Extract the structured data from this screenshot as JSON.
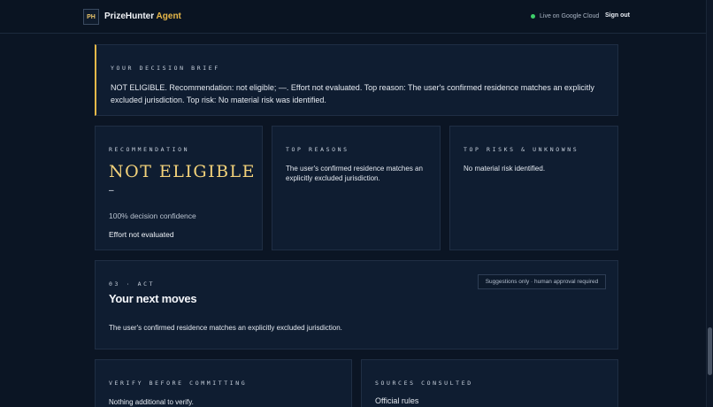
{
  "header": {
    "logo_text": "PH",
    "brand_name": "PrizeHunter",
    "brand_suffix": "Agent",
    "live_status": "Live on Google Cloud",
    "sign_out_label": "Sign out"
  },
  "brief": {
    "label": "YOUR DECISION BRIEF",
    "text": "NOT ELIGIBLE. Recommendation: not eligible; —. Effort not evaluated. Top reason: The user's confirmed residence matches an explicitly excluded jurisdiction. Top risk: No material risk was identified."
  },
  "recommendation": {
    "label": "RECOMMENDATION",
    "verdict": "NOT ELIGIBLE",
    "sub": "–",
    "confidence": "100% decision confidence",
    "effort": "Effort not evaluated"
  },
  "top_reasons": {
    "label": "TOP REASONS",
    "text": "The user's confirmed residence matches an explicitly excluded jurisdiction."
  },
  "top_risks": {
    "label": "TOP RISKS & UNKNOWNS",
    "text": "No material risk identified."
  },
  "act": {
    "label": "03 · ACT",
    "heading": "Your next moves",
    "badge": "Suggestions only · human approval required",
    "text": "The user's confirmed residence matches an explicitly excluded jurisdiction."
  },
  "verify": {
    "label": "VERIFY BEFORE COMMITTING",
    "text": "Nothing additional to verify."
  },
  "sources": {
    "label": "SOURCES CONSULTED",
    "text": "Official rules"
  },
  "colors": {
    "background": "#0b1524",
    "card": "#0f1d31",
    "accent_gold": "#e9b949",
    "verdict_gold": "#f3d27a",
    "live_green": "#3ecf6a"
  }
}
